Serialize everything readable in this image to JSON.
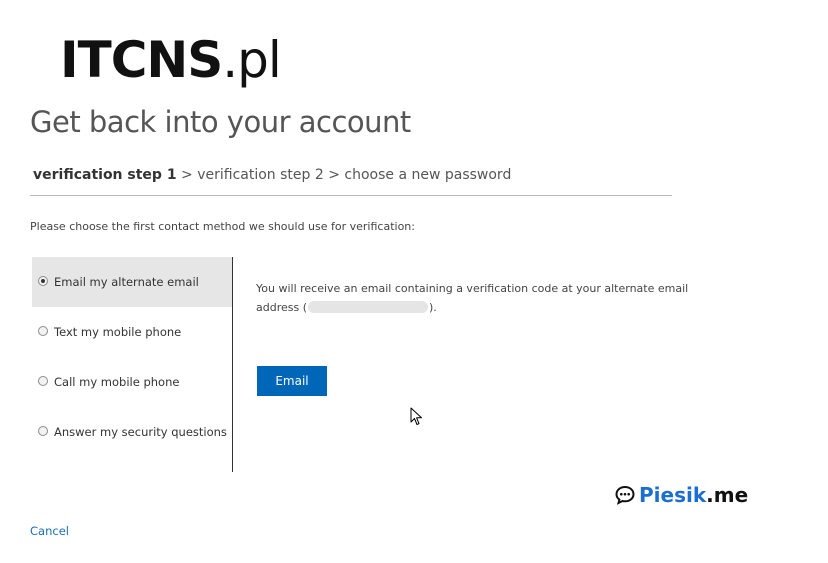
{
  "watermark_top": {
    "brand": "ITCNS",
    "domain": ".pl"
  },
  "header": {
    "title": "Get back into your account"
  },
  "breadcrumb": {
    "step1": "verification step 1",
    "sep1": ">",
    "step2": "verification step 2",
    "sep2": ">",
    "step3": "choose a new password"
  },
  "instructions": "Please choose the first contact method we should use for verification:",
  "methods": [
    {
      "label": "Email my alternate email",
      "selected": true
    },
    {
      "label": "Text my mobile phone",
      "selected": false
    },
    {
      "label": "Call my mobile phone",
      "selected": false
    },
    {
      "label": "Answer my security questions",
      "selected": false
    }
  ],
  "detail": {
    "text_before": "You will receive an email containing a verification code at your alternate email address (",
    "text_after": ")."
  },
  "email_button_label": "Email",
  "cancel_label": "Cancel",
  "watermark_bottom": {
    "brand": "Piesik",
    "tld": ".me"
  },
  "colors": {
    "accent": "#0067b8",
    "link": "#1a6fb5",
    "selected_bg": "#e6e6e6"
  },
  "icons": {
    "cursor": "mouse-pointer-icon",
    "radio": "radio-button-icon",
    "chat": "chat-bubble-icon"
  }
}
